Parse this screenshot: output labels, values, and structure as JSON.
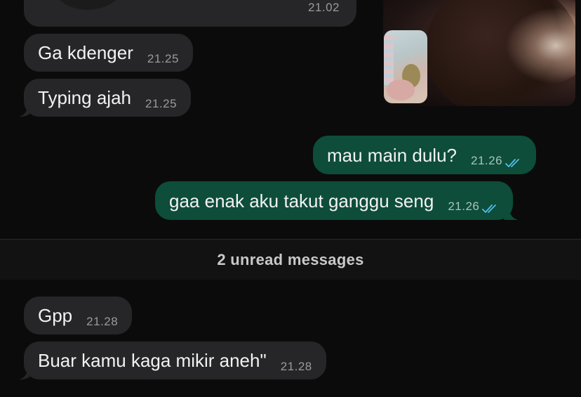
{
  "chat": {
    "previous_message": {
      "time": "21.02"
    },
    "messages": [
      {
        "text": "Ga kdenger",
        "time": "21.25",
        "direction": "incoming"
      },
      {
        "text": "Typing ajah",
        "time": "21.25",
        "direction": "incoming"
      },
      {
        "text": "mau main dulu?",
        "time": "21.26",
        "direction": "outgoing",
        "status": "read"
      },
      {
        "text": "gaa enak aku takut ganggu seng",
        "time": "21.26",
        "direction": "outgoing",
        "status": "read"
      }
    ],
    "unread_divider": "2 unread messages",
    "unread_messages": [
      {
        "text": "Gpp",
        "time": "21.28",
        "direction": "incoming"
      },
      {
        "text": "Buar kamu kaga mikir aneh\"",
        "time": "21.28",
        "direction": "incoming"
      }
    ]
  },
  "colors": {
    "background": "#0b0b0b",
    "incoming_bubble": "#262628",
    "outgoing_bubble": "#0d4d3a",
    "read_ticks": "#53bdeb"
  },
  "icons": {
    "read_receipt": "double-check-icon"
  }
}
